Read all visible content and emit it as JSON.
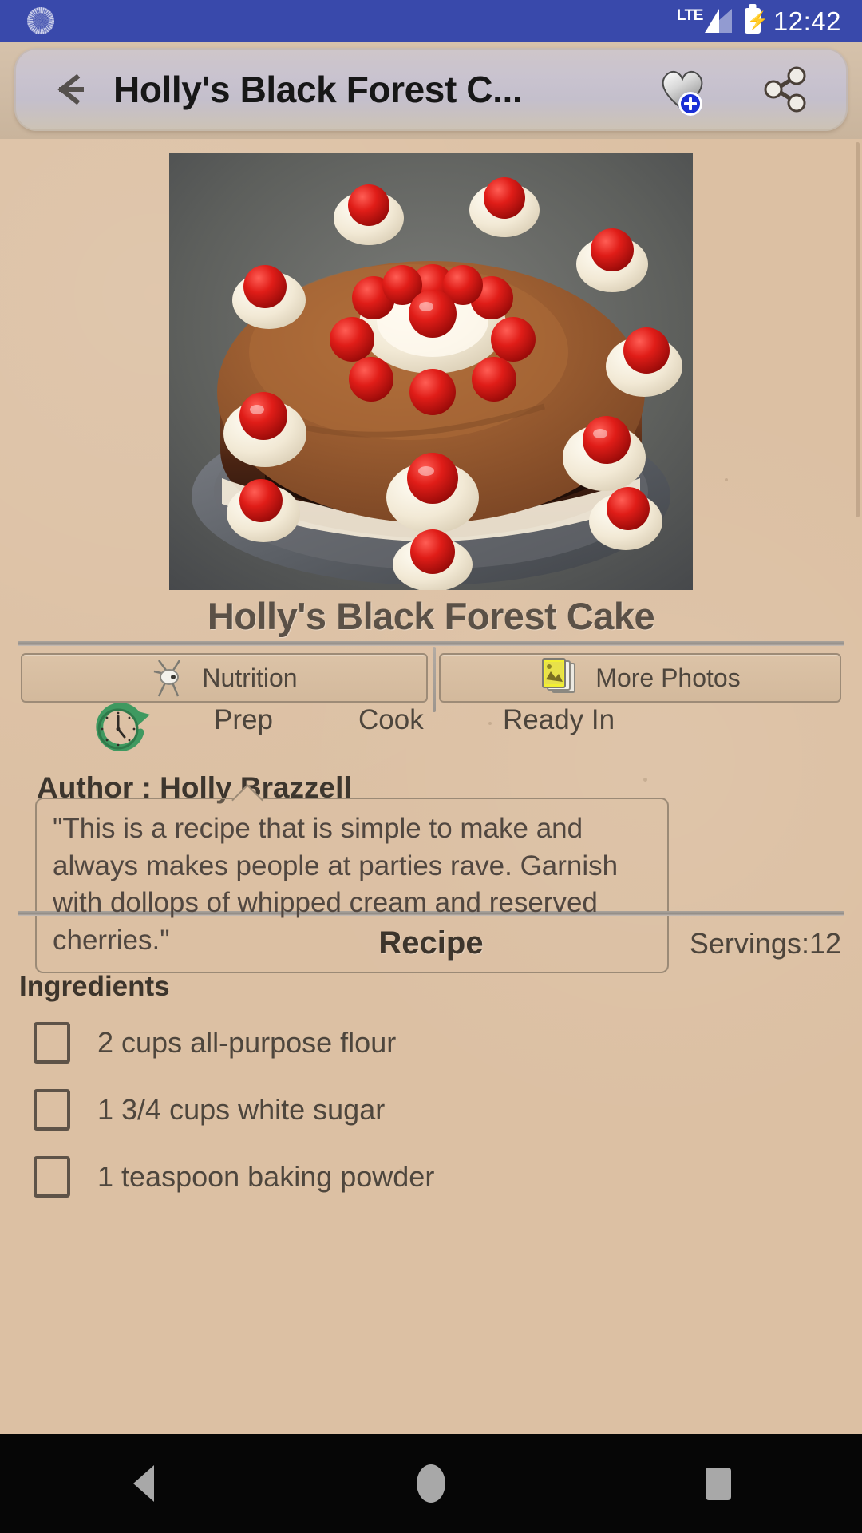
{
  "status_bar": {
    "left_icon": "spinner-icon",
    "network": "LTE",
    "signal_icon": "signal-bars-icon",
    "battery_icon": "battery-charging-icon",
    "time": "12:42",
    "background_color": "#3949ab"
  },
  "app_bar": {
    "back_icon": "back-arrow-icon",
    "title": "Holly's Black Forest C...",
    "favorite_icon": "heart-add-icon",
    "share_icon": "share-icon"
  },
  "recipe": {
    "hero_image_alt": "chocolate-black-forest-cake-photo",
    "title": "Holly's Black Forest Cake",
    "author_line": "Author : Holly Brazzell",
    "description": "\"This is a recipe that is simple to make and always makes people at parties rave.  Garnish with dollops of whipped cream and reserved cherries.\"",
    "section_title": "Recipe",
    "servings": "Servings:12",
    "ingredients_heading": "Ingredients",
    "ingredients": [
      {
        "text": "2 cups all-purpose flour",
        "checked": false
      },
      {
        "text": "1 3/4 cups white sugar",
        "checked": false
      },
      {
        "text": "1 teaspoon baking powder",
        "checked": false
      }
    ]
  },
  "action_buttons": [
    {
      "label": "Nutrition",
      "icon": "nutrition-icon"
    },
    {
      "label": "More Photos",
      "icon": "photos-stack-icon"
    }
  ],
  "time_row": {
    "clock_icon": "clock-refresh-icon",
    "labels": [
      "Prep",
      "Cook",
      "Ready In"
    ],
    "prep": "Prep",
    "cook": "Cook",
    "ready_in": "Ready In"
  },
  "nav_bar": {
    "back": "nav-back-icon",
    "home": "nav-home-icon",
    "recents": "nav-recents-icon"
  },
  "colors": {
    "status_bar": "#3949ab",
    "page_background": "#dcc0a3",
    "app_bar_pill": "#c9c3cf",
    "title_text": "#5b5147",
    "nav_bar": "#060606"
  }
}
